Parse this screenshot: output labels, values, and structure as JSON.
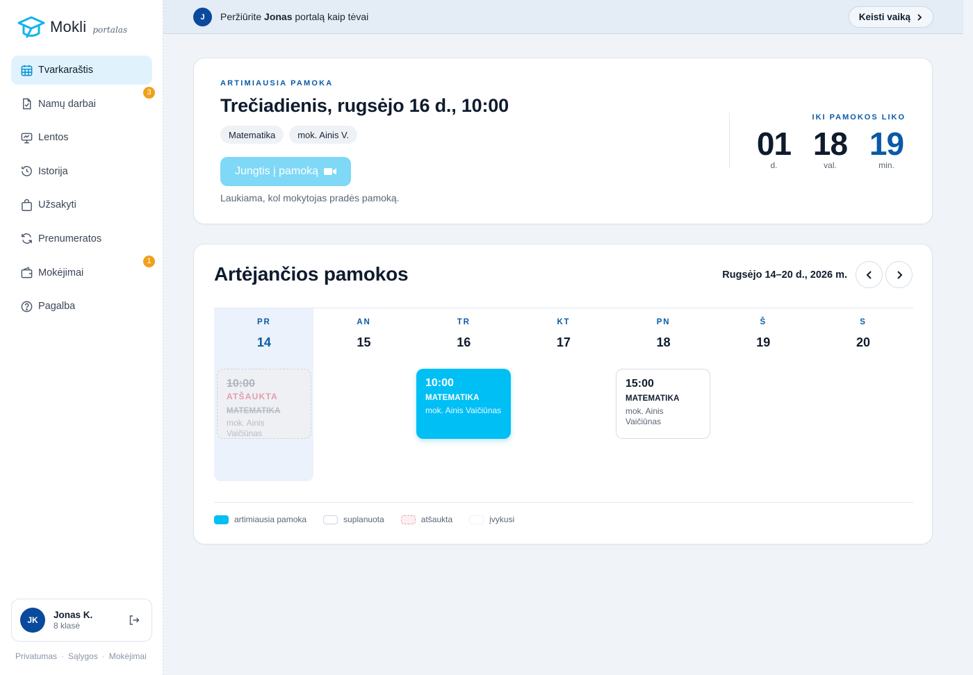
{
  "brand": {
    "name": "Mokli",
    "sub": "portalas"
  },
  "sidebar": {
    "items": [
      {
        "label": "Tvarkaraštis",
        "icon": "calendar-icon",
        "badge": null
      },
      {
        "label": "Namų darbai",
        "icon": "document-check-icon",
        "badge": "3"
      },
      {
        "label": "Lentos",
        "icon": "whiteboard-icon",
        "badge": null
      },
      {
        "label": "Istorija",
        "icon": "history-icon",
        "badge": null
      },
      {
        "label": "Užsakyti",
        "icon": "shopping-bag-icon",
        "badge": null
      },
      {
        "label": "Prenumeratos",
        "icon": "refresh-icon",
        "badge": null
      },
      {
        "label": "Mokėjimai",
        "icon": "wallet-icon",
        "badge": "1"
      },
      {
        "label": "Pagalba",
        "icon": "help-icon",
        "badge": null
      }
    ],
    "user": {
      "initials": "JK",
      "name": "Jonas K.",
      "grade": "8 klasė"
    },
    "footer": [
      "Privatumas",
      "Sąlygos",
      "Mokėjimai"
    ]
  },
  "banner": {
    "initial": "J",
    "text_before": "Peržiūrite ",
    "child_name": "Jonas",
    "text_after": " portalą kaip tėvai",
    "switch_label": "Keisti vaiką"
  },
  "next_lesson": {
    "eyebrow": "ARTIMIAUSIA PAMOKA",
    "title": "Trečiadienis, rugsėjo 16 d., 10:00",
    "subject": "Matematika",
    "teacher": "mok. Ainis V.",
    "join_label": "Jungtis į pamoką",
    "wait_text": "Laukiama, kol mokytojas pradės pamoką.",
    "countdown_label": "IKI PAMOKOS LIKO",
    "countdown": [
      {
        "value": "01",
        "unit": "d."
      },
      {
        "value": "18",
        "unit": "val."
      },
      {
        "value": "19",
        "unit": "min."
      }
    ]
  },
  "upcoming": {
    "title": "Artėjančios pamokos",
    "week_range": "Rugsėjo 14–20 d., 2026 m.",
    "days": [
      {
        "abbr": "PR",
        "num": "14"
      },
      {
        "abbr": "AN",
        "num": "15"
      },
      {
        "abbr": "TR",
        "num": "16"
      },
      {
        "abbr": "KT",
        "num": "17"
      },
      {
        "abbr": "PN",
        "num": "18"
      },
      {
        "abbr": "Š",
        "num": "19"
      },
      {
        "abbr": "S",
        "num": "20"
      }
    ],
    "lessons": {
      "cancelled": {
        "time": "10:00",
        "status": "ATŠAUKTA",
        "subject": "MATEMATIKA",
        "teacher": "mok. Ainis Vaičiūnas"
      },
      "nearest": {
        "time": "10:00",
        "subject": "MATEMATIKA",
        "teacher": "mok. Ainis Vaičiūnas"
      },
      "planned": {
        "time": "15:00",
        "subject": "MATEMATIKA",
        "teacher": "mok. Ainis Vaičiūnas"
      }
    },
    "legend": [
      "artimiausia pamoka",
      "suplanuota",
      "atšaukta",
      "įvykusi"
    ]
  },
  "colors": {
    "accent": "#00bff5",
    "primary": "#0a5aa8",
    "badge": "#f0a01c"
  }
}
